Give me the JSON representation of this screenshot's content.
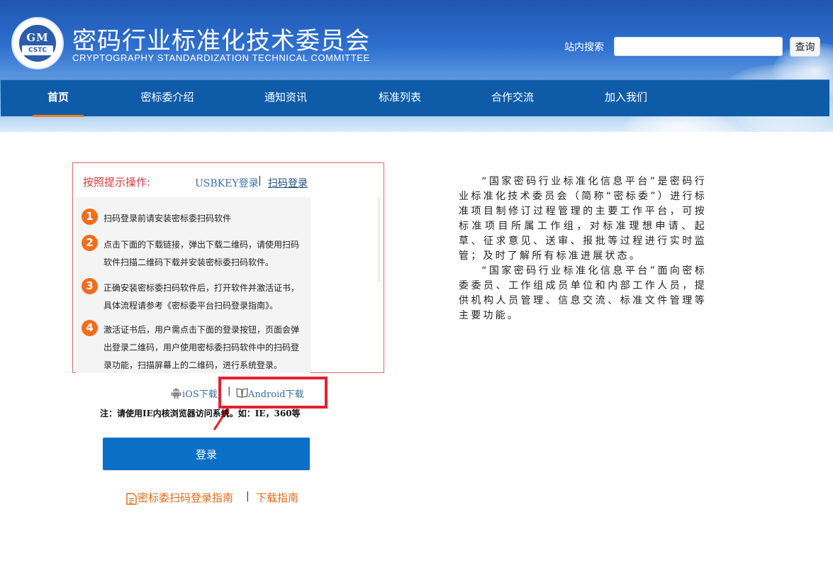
{
  "header": {
    "logo_text": "GM",
    "logo_abbr": "CSTC",
    "title": "密码行业标准化技术委员会",
    "subtitle": "CRYPTOGRAPHY STANDARDIZATION TECHNICAL COMMITTEE",
    "search_label": "站内搜索",
    "search_value": "",
    "search_button": "查询"
  },
  "nav": {
    "items": [
      {
        "label": "首页",
        "active": true
      },
      {
        "label": "密标委介绍"
      },
      {
        "label": "通知资讯"
      },
      {
        "label": "标准列表"
      },
      {
        "label": "合作交流"
      },
      {
        "label": "加入我们"
      }
    ]
  },
  "login": {
    "prompt": "按照提示操作:",
    "tab_usbkey": "USBKEY登录",
    "tab_separator": "|",
    "tab_scan": "扫码登录",
    "steps": [
      {
        "num": "1",
        "text": "扫码登录前请安装密标委扫码软件"
      },
      {
        "num": "2",
        "text": "点击下面的下载链接，弹出下载二维码，请使用扫码软件扫描二维码下载并安装密标委扫码软件。"
      },
      {
        "num": "3",
        "text": "正确安装密标委扫码软件后，打开软件并激活证书，具体流程请参考《密标委平台扫码登录指南》。"
      },
      {
        "num": "4",
        "text": "激活证书后，用户需点击下面的登录按钮，页面会弹出登录二维码，用户使用密标委扫码软件中的扫码登录功能，扫描屏幕上的二维码，进行系统登录。"
      }
    ],
    "download_ios": "iOS下载",
    "download_separator": "|",
    "download_android": "Android下载",
    "note": "注：请使用IE内核浏览器访问系统。如：IE，360等",
    "login_button": "登录",
    "guide_link": "密标委扫码登录指南",
    "guide_separator": "|",
    "download_guide_link": "下载指南"
  },
  "intro": {
    "paragraphs": [
      "“国家密码行业标准化信息平台”是密码行业标准化技术委员会（简称“密标委”）进行标准项目制修订过程管理的主要工作平台，可按标准项目所属工作组，对标准理想申请、起草、征求意见、送审、报批等过程进行实时监管；及时了解所有标准进展状态。",
      "“国家密码行业标准化信息平台”面向密标委委员、工作组成员单位和内部工作人员，提供机构人员管理、信息交流、标准文件管理等主要功能。"
    ]
  },
  "colors": {
    "nav_bg": "#0e5ca8",
    "nav_active_underline": "#f07b1d",
    "step_badge": "#f26d1c",
    "login_button": "#0b6fc6",
    "guide_link": "#e06a17",
    "highlight": "#e4202e",
    "prompt_red": "#d23b3b"
  },
  "icons": {
    "logo": "gm-cstc-logo",
    "ios": "android-robot-icon",
    "android": "book-icon",
    "guide": "document-icon",
    "annotation": "red-arrow-icon"
  }
}
